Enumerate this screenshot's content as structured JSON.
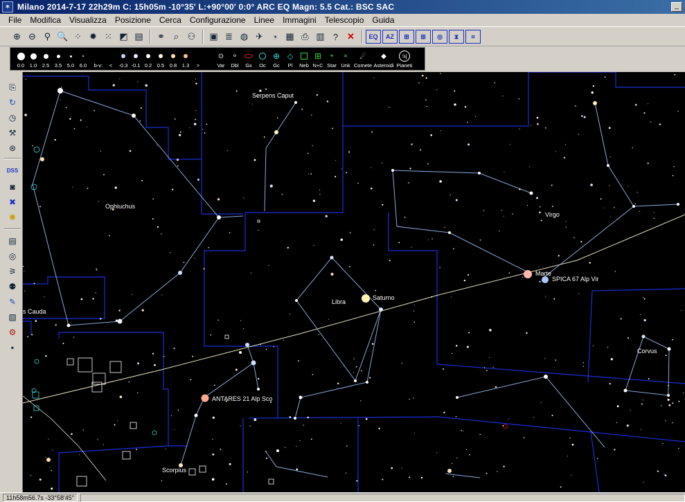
{
  "window": {
    "title": "Milano 2014-7-17  22h29m C: 15h05m -10°35' L:+90°00' 0:0° ARC EQ Magn: 5.5 Cat.: BSC SAC",
    "min_label": "_"
  },
  "menu": [
    "File",
    "Modifica",
    "Visualizza",
    "Posizione",
    "Cerca",
    "Configurazione",
    "Linee",
    "Immagini",
    "Telescopio",
    "Guida"
  ],
  "toolbar1": {
    "group1": [
      {
        "name": "zoom-in-icon",
        "glyph": "⊕"
      },
      {
        "name": "zoom-out-icon",
        "glyph": "⊖"
      },
      {
        "name": "zoom-tool-icon",
        "glyph": "⚲"
      },
      {
        "name": "search-icon",
        "glyph": "🔍"
      },
      {
        "name": "scatter-icon",
        "glyph": "⁘"
      },
      {
        "name": "target-icon",
        "glyph": "✹"
      },
      {
        "name": "objects-icon",
        "glyph": "⁙"
      },
      {
        "name": "contrast-icon",
        "glyph": "◩"
      },
      {
        "name": "document-icon",
        "glyph": "▤"
      }
    ],
    "group2": [
      {
        "name": "binoculars-icon",
        "glyph": "⚭"
      },
      {
        "name": "find-icon",
        "glyph": "⌕"
      },
      {
        "name": "user-search-icon",
        "glyph": "⚇"
      }
    ],
    "group3": [
      {
        "name": "save-icon",
        "glyph": "▣"
      },
      {
        "name": "list-icon",
        "glyph": "≣"
      },
      {
        "name": "globe-icon",
        "glyph": "◍"
      },
      {
        "name": "satellite-icon",
        "glyph": "✈"
      },
      {
        "name": "gauge-icon",
        "glyph": "◔"
      },
      {
        "name": "calendar-icon",
        "glyph": "▦"
      },
      {
        "name": "print-icon",
        "glyph": "⎙"
      },
      {
        "name": "print-setup-icon",
        "glyph": "▥"
      },
      {
        "name": "help-icon",
        "glyph": "?"
      }
    ],
    "close_glyph": "✕",
    "group4": [
      {
        "name": "eq-mode-icon",
        "glyph": "EQ"
      },
      {
        "name": "az-mode-icon",
        "glyph": "AZ"
      },
      {
        "name": "grid-mode-icon",
        "glyph": "⊞"
      },
      {
        "name": "grid-alt-icon",
        "glyph": "⊞"
      },
      {
        "name": "target-circle-icon",
        "glyph": "◎"
      },
      {
        "name": "hourglass-icon",
        "glyph": "⧗"
      },
      {
        "name": "frame-icon",
        "glyph": "⌗"
      }
    ]
  },
  "legend": {
    "mag_labels": [
      "0.0",
      "1.0",
      "2.5",
      "3.5",
      "5.0",
      "6.0"
    ],
    "bv_label": "b-v:",
    "bv_labels": [
      "<",
      "-0.3",
      "-0.1",
      "0.2",
      "0.5",
      "0.8",
      "1.3",
      ">"
    ],
    "bv_colors": [
      "#a8c8ff",
      "#c8d8ff",
      "#e8ecff",
      "#ffffff",
      "#fff4d8",
      "#ffe0b0",
      "#ffc090",
      "#ff9070"
    ],
    "object_labels": [
      "Var",
      "Dbl",
      "Gx",
      "Oc",
      "Gc",
      "Pl",
      "Neb",
      "N+C",
      "Star",
      "Unk",
      "Comete",
      "Asteroidi",
      "Pianeti"
    ],
    "pianeti_glyph": "♃"
  },
  "sky": {
    "constellations": [
      "Serpens Caput",
      "Ophiuchus",
      "Virgo",
      "Libra",
      "s Cauda",
      "Corvus",
      "Scorpius"
    ],
    "objects": [
      "Marte",
      "SPICA 67 Alp Vir",
      "Saturno",
      "ANTARES 21 Alp Sco"
    ]
  },
  "status": {
    "coords": "11h58m56.7s -33°58'45\""
  }
}
